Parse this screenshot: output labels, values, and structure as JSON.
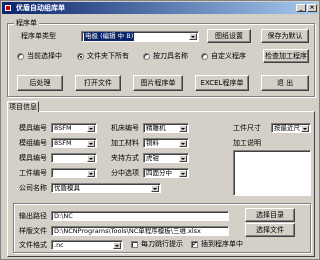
{
  "window": {
    "title": "优盾自动组库单"
  },
  "program_group": {
    "title": "程序单",
    "type_label": "程序单类型",
    "type_value": "电极 (编辑 中 B)",
    "btn_settings": "图纸设置",
    "btn_save_settings": "保存为默认",
    "radios": [
      {
        "label": "当前选择中",
        "checked": false
      },
      {
        "label": "文件夹下所有",
        "checked": true
      },
      {
        "label": "按刀具名称",
        "checked": false
      },
      {
        "label": "自定义程序",
        "checked": false
      }
    ],
    "btn_check": "检查加工程序",
    "btn_process": "后处理",
    "btn_open": "打开文件",
    "btn_graph_sheet": "图片程序单",
    "btn_excel_sheet": "EXCEL程序单",
    "btn_exit": "退 出"
  },
  "tabs": [
    {
      "label": "项目信息"
    }
  ],
  "info": {
    "rows": [
      {
        "label": "模具编号",
        "value": "8SFM",
        "dropdown": true
      },
      {
        "label": "模组编号",
        "value": "8SFM",
        "dropdown": true
      },
      {
        "label": "模具编号",
        "value": "",
        "dropdown": true
      },
      {
        "label": "工件编号",
        "value": "",
        "dropdown": true
      },
      {
        "label": "公司名称",
        "value": "优盾模具",
        "dropdown": true
      }
    ],
    "mid_rows": [
      {
        "label": "机床编号",
        "value": "精雕机",
        "dropdown": true
      },
      {
        "label": "加工材料",
        "value": "铜料",
        "dropdown": true
      },
      {
        "label": "夹持方式",
        "value": "虎钳",
        "dropdown": true
      },
      {
        "label": "分中选项",
        "value": "四面分中",
        "dropdown": true
      }
    ],
    "workpiece_size_label": "工件尺寸",
    "workpiece_size_value": "按最近尺寸",
    "notes_label": "加工说明"
  },
  "paths": {
    "output_label": "输出路径",
    "output_value": "D:\\NC",
    "btn_choose_dir": "选择目录",
    "template_label": "样版文件",
    "template_value": "D:\\NCNPrograms\\Tools\\NC单程序模板\\三维.xlsx",
    "btn_choose_file": "选择文件",
    "format_label": "文件格式",
    "format_value": ".nc",
    "check_split": {
      "label": "每刀跳行提示",
      "checked": false
    },
    "check_insert": {
      "label": "插到程序单中",
      "checked": true
    }
  }
}
